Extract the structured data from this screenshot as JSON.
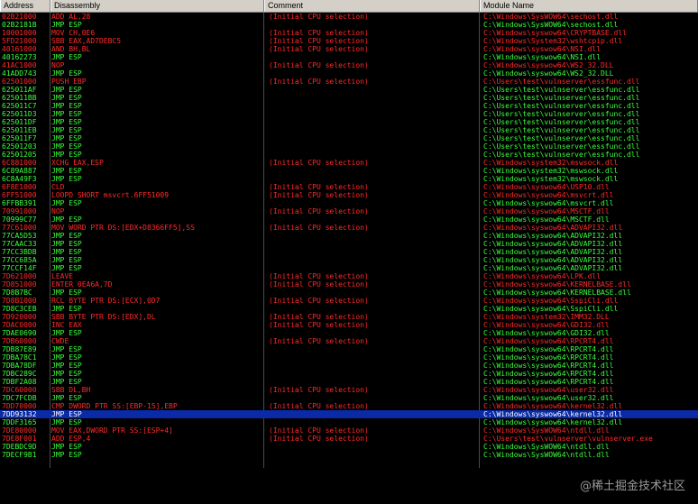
{
  "columns": {
    "address": "Address",
    "disassembly": "Disassembly",
    "comment": "Comment",
    "module": "Module Name"
  },
  "rows": [
    {
      "addr": "02B21000",
      "dis": "ADD AL,28",
      "com": "(Initial CPU selection)",
      "mod": "C:\\Windows\\SysWOW64\\sechost.dll",
      "c": "red"
    },
    {
      "addr": "02B2181B",
      "dis": "JMP ESP",
      "com": "",
      "mod": "C:\\Windows\\SysWOW64\\sechost.dll",
      "c": "grn"
    },
    {
      "addr": "10001000",
      "dis": "MOV CH,0E6",
      "com": "(Initial CPU selection)",
      "mod": "C:\\Windows\\syswow64\\CRYPTBASE.dll",
      "c": "red"
    },
    {
      "addr": "5FD21000",
      "dis": "SBB EAX,AD7DEBC5",
      "com": "(Initial CPU selection)",
      "mod": "C:\\Windows\\System32\\wshtcpip.dll",
      "c": "red"
    },
    {
      "addr": "40161000",
      "dis": "AND BH,BL",
      "com": "(Initial CPU selection)",
      "mod": "C:\\Windows\\syswow64\\NSI.dll",
      "c": "red"
    },
    {
      "addr": "40162273",
      "dis": "JMP ESP",
      "com": "",
      "mod": "C:\\Windows\\syswow64\\NSI.dll",
      "c": "grn"
    },
    {
      "addr": "41AC1000",
      "dis": "NOP",
      "com": "(Initial CPU selection)",
      "mod": "C:\\Windows\\syswow64\\WS2_32.DLL",
      "c": "red"
    },
    {
      "addr": "41ADD743",
      "dis": "JMP ESP",
      "com": "",
      "mod": "C:\\Windows\\syswow64\\WS2_32.DLL",
      "c": "grn"
    },
    {
      "addr": "62501000",
      "dis": "PUSH EBP",
      "com": "(Initial CPU selection)",
      "mod": "C:\\Users\\test\\vulnserver\\essfunc.dll",
      "c": "red"
    },
    {
      "addr": "625011AF",
      "dis": "JMP ESP",
      "com": "",
      "mod": "C:\\Users\\test\\vulnserver\\essfunc.dll",
      "c": "grn"
    },
    {
      "addr": "625011BB",
      "dis": "JMP ESP",
      "com": "",
      "mod": "C:\\Users\\test\\vulnserver\\essfunc.dll",
      "c": "grn"
    },
    {
      "addr": "625011C7",
      "dis": "JMP ESP",
      "com": "",
      "mod": "C:\\Users\\test\\vulnserver\\essfunc.dll",
      "c": "grn"
    },
    {
      "addr": "625011D3",
      "dis": "JMP ESP",
      "com": "",
      "mod": "C:\\Users\\test\\vulnserver\\essfunc.dll",
      "c": "grn"
    },
    {
      "addr": "625011DF",
      "dis": "JMP ESP",
      "com": "",
      "mod": "C:\\Users\\test\\vulnserver\\essfunc.dll",
      "c": "grn"
    },
    {
      "addr": "625011EB",
      "dis": "JMP ESP",
      "com": "",
      "mod": "C:\\Users\\test\\vulnserver\\essfunc.dll",
      "c": "grn"
    },
    {
      "addr": "625011F7",
      "dis": "JMP ESP",
      "com": "",
      "mod": "C:\\Users\\test\\vulnserver\\essfunc.dll",
      "c": "grn"
    },
    {
      "addr": "62501203",
      "dis": "JMP ESP",
      "com": "",
      "mod": "C:\\Users\\test\\vulnserver\\essfunc.dll",
      "c": "grn"
    },
    {
      "addr": "62501205",
      "dis": "JMP ESP",
      "com": "",
      "mod": "C:\\Users\\test\\vulnserver\\essfunc.dll",
      "c": "grn"
    },
    {
      "addr": "6C881000",
      "dis": "XCHG EAX,ESP",
      "com": "(Initial CPU selection)",
      "mod": "C:\\Windows\\system32\\mswsock.dll",
      "c": "red"
    },
    {
      "addr": "6C89A887",
      "dim": "",
      "dis": "JMP ESP",
      "com": "",
      "mod": "C:\\Windows\\system32\\mswsock.dll",
      "c": "grn"
    },
    {
      "addr": "6C8A49F3",
      "dis": "JMP ESP",
      "com": "",
      "mod": "C:\\Windows\\system32\\mswsock.dll",
      "c": "grn"
    },
    {
      "addr": "6F8E1000",
      "dis": "CLD",
      "com": "(Initial CPU selection)",
      "mod": "C:\\Windows\\syswow64\\USP10.dll",
      "c": "red"
    },
    {
      "addr": "6FF51000",
      "dis": "LOOPD SHORT msvcrt.6FF51009",
      "com": "(Initial CPU selection)",
      "mod": "C:\\Windows\\syswow64\\msvcrt.dll",
      "c": "red"
    },
    {
      "addr": "6FFBB391",
      "dis": "JMP ESP",
      "com": "",
      "mod": "C:\\Windows\\syswow64\\msvcrt.dll",
      "c": "grn"
    },
    {
      "addr": "70991000",
      "dis": "NOP",
      "com": "(Initial CPU selection)",
      "mod": "C:\\Windows\\syswow64\\MSCTF.dll",
      "c": "red"
    },
    {
      "addr": "70999C77",
      "dis": "JMP ESP",
      "com": "",
      "mod": "C:\\Windows\\syswow64\\MSCTF.dll",
      "c": "grn"
    },
    {
      "addr": "77C61000",
      "dis": "MOV WORD PTR DS:[EDX+D8366FF5],SS",
      "com": "(Initial CPU selection)",
      "mod": "C:\\Windows\\syswow64\\ADVAPI32.dll",
      "c": "red"
    },
    {
      "addr": "77CA5D53",
      "dis": "JMP ESP",
      "com": "",
      "mod": "C:\\Windows\\syswow64\\ADVAPI32.dll",
      "c": "grn"
    },
    {
      "addr": "77CAAC33",
      "dis": "JMP ESP",
      "com": "",
      "mod": "C:\\Windows\\syswow64\\ADVAPI32.dll",
      "c": "grn"
    },
    {
      "addr": "77CC3BDB",
      "dis": "JMP ESP",
      "com": "",
      "mod": "C:\\Windows\\syswow64\\ADVAPI32.dll",
      "c": "grn"
    },
    {
      "addr": "77CC685A",
      "dis": "JMP ESP",
      "com": "",
      "mod": "C:\\Windows\\syswow64\\ADVAPI32.dll",
      "c": "grn"
    },
    {
      "addr": "77CCF14F",
      "dis": "JMP ESP",
      "com": "",
      "mod": "C:\\Windows\\syswow64\\ADVAPI32.dll",
      "c": "grn"
    },
    {
      "addr": "7D621000",
      "dis": "LEAVE",
      "com": "(Initial CPU selection)",
      "mod": "C:\\Windows\\syswow64\\LPK.dll",
      "c": "red"
    },
    {
      "addr": "7D851000",
      "dis": "ENTER 0EA6A,7D",
      "com": "(Initial CPU selection)",
      "mod": "C:\\Windows\\syswow64\\KERNELBASE.dll",
      "c": "red"
    },
    {
      "addr": "7D8B7BC",
      "dis": "JMP ESP",
      "com": "",
      "mod": "C:\\Windows\\syswow64\\KERNELBASE.dll",
      "c": "grn"
    },
    {
      "addr": "7D8B1000",
      "dis": "RCL BYTE PTR DS:[ECX],0D7",
      "com": "(Initial CPU selection)",
      "mod": "C:\\Windows\\syswow64\\SspiCli.dll",
      "c": "red"
    },
    {
      "addr": "7D8C3CEB",
      "dis": "JMP ESP",
      "com": "",
      "mod": "C:\\Windows\\syswow64\\SspiCli.dll",
      "c": "grn"
    },
    {
      "addr": "7D920000",
      "dis": "SBB BYTE PTR DS:[EDX],DL",
      "com": "(Initial CPU selection)",
      "mod": "C:\\Windows\\system32\\IMM32.DLL",
      "c": "red"
    },
    {
      "addr": "7DAC0000",
      "dis": "INC EAX",
      "com": "(Initial CPU selection)",
      "mod": "C:\\Windows\\syswow64\\GDI32.dll",
      "c": "red"
    },
    {
      "addr": "7DAE0690",
      "dis": "JMP ESP",
      "com": "",
      "mod": "C:\\Windows\\syswow64\\GDI32.dll",
      "c": "grn"
    },
    {
      "addr": "7DB60000",
      "dis": "CWDE",
      "com": "(Initial CPU selection)",
      "mod": "C:\\Windows\\syswow64\\RPCRT4.dll",
      "c": "red"
    },
    {
      "addr": "7DB87E89",
      "dis": "JMP ESP",
      "com": "",
      "mod": "C:\\Windows\\syswow64\\RPCRT4.dll",
      "c": "grn"
    },
    {
      "addr": "7DBA78C1",
      "dis": "JMP ESP",
      "com": "",
      "mod": "C:\\Windows\\syswow64\\RPCRT4.dll",
      "c": "grn"
    },
    {
      "addr": "7DBA78DF",
      "dis": "JMP ESP",
      "com": "",
      "mod": "C:\\Windows\\syswow64\\RPCRT4.dll",
      "c": "grn"
    },
    {
      "addr": "7DBC289C",
      "dis": "JMP ESP",
      "com": "",
      "mod": "C:\\Windows\\syswow64\\RPCRT4.dll",
      "c": "grn"
    },
    {
      "addr": "7DBF2A08",
      "dis": "JMP ESP",
      "com": "",
      "mod": "C:\\Windows\\syswow64\\RPCRT4.dll",
      "c": "grn"
    },
    {
      "addr": "7DC60000",
      "dis": "SBB DL,BH",
      "com": "(Initial CPU selection)",
      "mod": "C:\\Windows\\syswow64\\user32.dll",
      "c": "red"
    },
    {
      "addr": "7DC7FCDB",
      "dis": "JMP ESP",
      "com": "",
      "mod": "C:\\Windows\\syswow64\\user32.dll",
      "c": "grn"
    },
    {
      "addr": "7DD70000",
      "dis": "CMP DWORD PTR SS:[EBP-15],EBP",
      "com": "(Initial CPU selection)",
      "mod": "C:\\Windows\\syswow64\\kernel32.dll",
      "c": "red"
    },
    {
      "addr": "7DD93132",
      "dis": "JMP ESP",
      "com": "",
      "mod": "C:\\Windows\\syswow64\\kernel32.dll",
      "c": "grn",
      "sel": true
    },
    {
      "addr": "7DDF3165",
      "dis": "JMP ESP",
      "com": "",
      "mod": "C:\\Windows\\syswow64\\kernel32.dll",
      "c": "grn"
    },
    {
      "addr": "7DE80000",
      "dis": "MOV EAX,DWORD PTR SS:[ESP+4]",
      "com": "(Initial CPU selection)",
      "mod": "C:\\Windows\\SysWOW64\\ntdll.dll",
      "c": "red"
    },
    {
      "addr": "7DE8F001",
      "dis": "ADD ESP,4",
      "com": "(Initial CPU selection)",
      "mod": "C:\\Users\\test\\vulnserver\\vulnserver.exe",
      "c": "red"
    },
    {
      "addr": "7DEBDC9D",
      "dis": "JMP ESP",
      "com": "",
      "mod": "C:\\Windows\\SysWOW64\\ntdll.dll",
      "c": "grn"
    },
    {
      "addr": "7DECF9B1",
      "dis": "JMP ESP",
      "com": "",
      "mod": "C:\\Windows\\SysWOW64\\ntdll.dll",
      "c": "grn"
    }
  ],
  "watermark": "@稀土掘金技术社区",
  "colors": {
    "red": "#ff2a2a",
    "green": "#3cff3c",
    "selection": "#0a2aa8",
    "header": "#d4d0c8",
    "background": "#000000"
  }
}
